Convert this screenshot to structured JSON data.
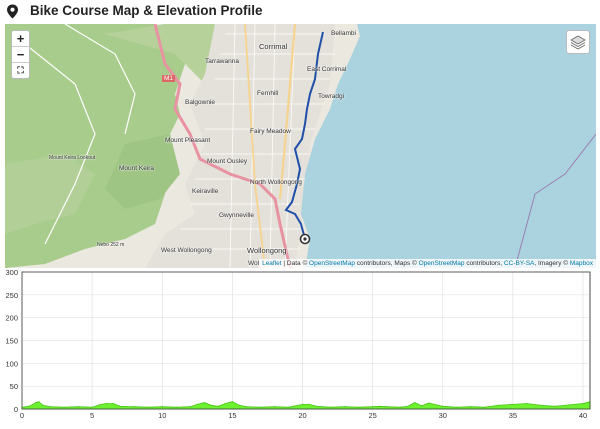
{
  "header": {
    "title": "Bike Course Map & Elevation Profile",
    "icon": "map-pin-icon"
  },
  "map": {
    "zoom_in": "+",
    "zoom_out": "−",
    "fullscreen": "⛶",
    "layers_icon": "layers-icon",
    "labels": [
      {
        "key": "bellambi",
        "text": "Bellambi"
      },
      {
        "key": "corrimal",
        "text": "Corrimal"
      },
      {
        "key": "east_corrimal",
        "text": "East Corrimal"
      },
      {
        "key": "tarrawanna",
        "text": "Tarrawanna"
      },
      {
        "key": "fernhill",
        "text": "Fernhill"
      },
      {
        "key": "towradgi",
        "text": "Towradgi"
      },
      {
        "key": "balgownie",
        "text": "Balgownie"
      },
      {
        "key": "fairy_meadow",
        "text": "Fairy Meadow"
      },
      {
        "key": "mount_pleasant",
        "text": "Mount Pleasant"
      },
      {
        "key": "mount_ousley",
        "text": "Mount Ousley"
      },
      {
        "key": "mount_keira",
        "text": "Mount Keira"
      },
      {
        "key": "north_wollongong",
        "text": "North Wollongong"
      },
      {
        "key": "keiraville",
        "text": "Keiraville"
      },
      {
        "key": "gwynneville",
        "text": "Gwynneville"
      },
      {
        "key": "west_wollongong",
        "text": "West Wollongong"
      },
      {
        "key": "wollongong",
        "text": "Wollongong"
      },
      {
        "key": "wol",
        "text": "Wol"
      },
      {
        "key": "m1",
        "text": "M1"
      },
      {
        "key": "lookout",
        "text": "Mount Keira Lookout"
      },
      {
        "key": "nebo",
        "text": "Nebo 252 m"
      }
    ],
    "attribution": {
      "leaflet": "Leaflet",
      "sep1": " | Data © ",
      "osm1": "OpenStreetMap",
      "mid1": " contributors, Maps © ",
      "osm2": "OpenStreetMap",
      "mid2": " contributors, ",
      "ccbysa": "CC-BY-SA",
      "mid3": ", Imagery © ",
      "mapbox": "Mapbox"
    },
    "colors": {
      "water": "#abd3df",
      "land": "#ebe8df",
      "forest": "#b6d19a",
      "route": "#1f4fa8",
      "road_major": "#e892a2",
      "road_minor": "#f6d38e"
    }
  },
  "chart_data": {
    "type": "area",
    "x_ticks": [
      "0",
      "5",
      "10",
      "15",
      "20",
      "25",
      "30",
      "35",
      "40"
    ],
    "y_ticks": [
      "0",
      "50",
      "100",
      "150",
      "200",
      "250",
      "300"
    ],
    "xlim": [
      0,
      40.5
    ],
    "ylim": [
      0,
      300
    ],
    "grid": true,
    "fill_color": "#6df02e",
    "line_color": "#4cc71a",
    "x": [
      0,
      0.5,
      1,
      1.2,
      1.5,
      2,
      3,
      4,
      5,
      5.5,
      6,
      6.5,
      7,
      8,
      9,
      10,
      11,
      12,
      12.5,
      13,
      13.5,
      14,
      14.5,
      15,
      15.5,
      16,
      17,
      18,
      19,
      20,
      20.5,
      21,
      22,
      23,
      24,
      25,
      25.5,
      26,
      27,
      27.5,
      28,
      28.5,
      29,
      30,
      31,
      32,
      33,
      34,
      35,
      36,
      37,
      38,
      39,
      40,
      40.5
    ],
    "y": [
      4,
      6,
      14,
      16,
      8,
      5,
      4,
      5,
      4,
      9,
      12,
      12,
      6,
      5,
      4,
      5,
      4,
      5,
      10,
      14,
      8,
      6,
      12,
      16,
      8,
      5,
      4,
      5,
      4,
      10,
      10,
      6,
      4,
      5,
      4,
      5,
      6,
      5,
      4,
      6,
      14,
      7,
      13,
      6,
      4,
      5,
      4,
      8,
      10,
      12,
      8,
      6,
      9,
      12,
      16
    ]
  }
}
